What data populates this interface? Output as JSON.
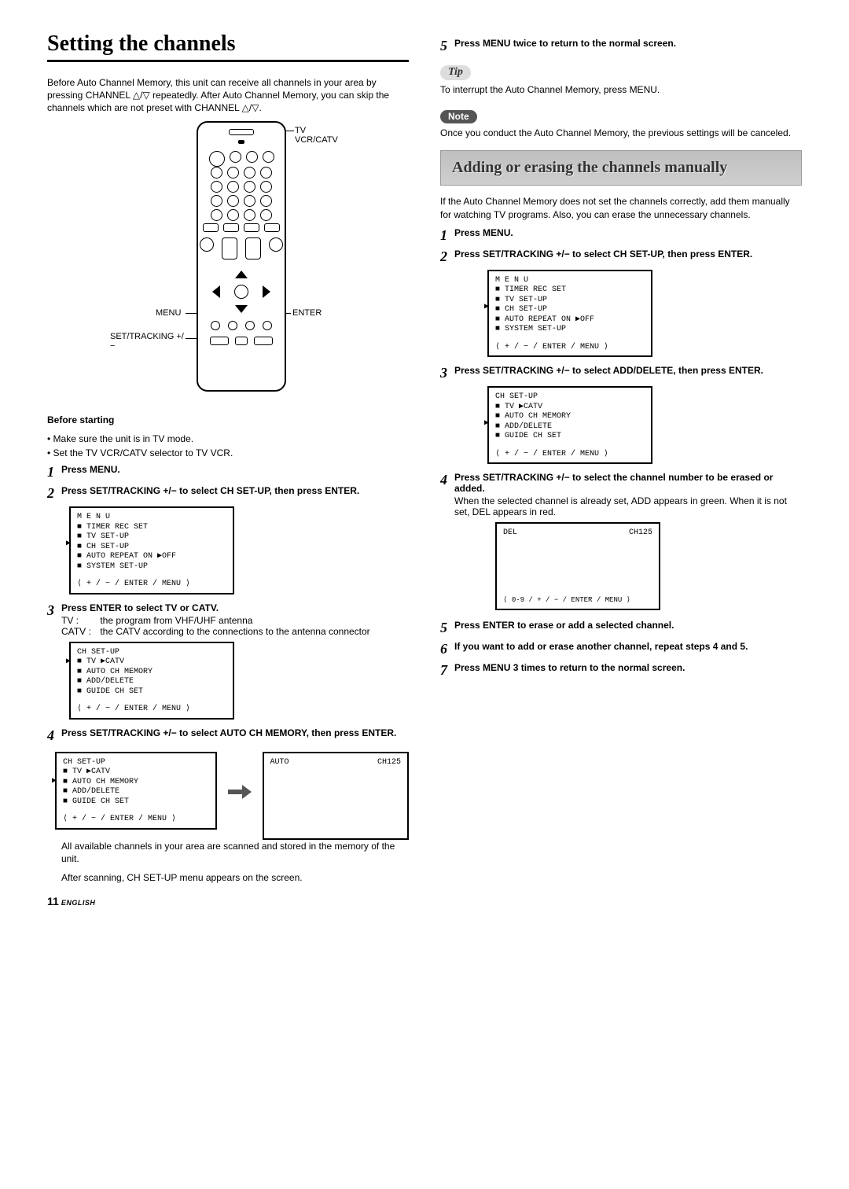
{
  "title": "Setting the channels",
  "intro": "Before Auto Channel Memory, this unit can receive all channels in your area by pressing CHANNEL △/▽ repeatedly. After Auto Channel Memory, you can skip the channels which are not preset with CHANNEL △/▽.",
  "remote_labels": {
    "tv_vcr_catv": "TV VCR/CATV",
    "menu": "MENU",
    "enter": "ENTER",
    "set_tracking": "SET/TRACKING +/−"
  },
  "before_starting": {
    "heading": "Before starting",
    "items": [
      "Make sure the unit is in TV mode.",
      "Set the TV VCR/CATV selector to TV VCR."
    ]
  },
  "left_steps": {
    "s1": "Press MENU.",
    "s2": "Press SET/TRACKING +/− to select CH SET-UP, then press ENTER.",
    "s3_title": "Press ENTER to select TV or CATV.",
    "s3_tv_label": "TV :",
    "s3_tv": "the program from VHF/UHF antenna",
    "s3_catv_label": "CATV :",
    "s3_catv": "the CATV according to the connections to the antenna connector",
    "s4": "Press SET/TRACKING +/− to select AUTO CH MEMORY, then press ENTER.",
    "s4_note1": "All available channels in your area are scanned and stored in the memory of the unit.",
    "s4_note2": "After scanning, CH SET-UP menu appears on the screen."
  },
  "menu1": {
    "title": "M E N U",
    "items": [
      "TIMER REC SET",
      "TV SET-UP",
      "CH SET-UP",
      "AUTO REPEAT   ON ▶OFF",
      "SYSTEM SET-UP"
    ],
    "footer": "⟨ + / − / ENTER / MENU ⟩"
  },
  "menu2": {
    "title": "CH SET-UP",
    "items": [
      "TV ▶CATV",
      "AUTO CH MEMORY",
      "ADD/DELETE",
      "GUIDE CH SET"
    ],
    "footer": "⟨ + / − / ENTER / MENU ⟩"
  },
  "menu3": {
    "title": "CH SET-UP",
    "items": [
      "TV ▶CATV",
      "AUTO CH MEMORY",
      "ADD/DELETE",
      "GUIDE CH SET"
    ],
    "footer": "⟨ + / − / ENTER / MENU ⟩"
  },
  "screen_auto": {
    "tl": "AUTO",
    "tr": "CH125"
  },
  "right": {
    "s5": "Press MENU twice to return to the normal screen.",
    "tip_label": "Tip",
    "tip": "To interrupt the Auto Channel Memory, press MENU.",
    "note_label": "Note",
    "note": "Once you conduct the Auto Channel Memory, the previous settings will be canceled.",
    "section_title": "Adding or erasing the channels manually",
    "section_intro": "If the Auto Channel Memory does not set the channels correctly, add them manually for watching TV programs. Also, you can erase the unnecessary channels.",
    "r1": "Press MENU.",
    "r2": "Press SET/TRACKING +/−  to select CH SET-UP, then press ENTER.",
    "r3": "Press SET/TRACKING +/− to select ADD/DELETE, then press ENTER.",
    "r4_title": "Press SET/TRACKING +/− to select the channel number to be erased or added.",
    "r4_body": "When the selected channel is already set, ADD appears in green. When it is not set, DEL appears in red.",
    "r5": "Press ENTER to erase or add a selected channel.",
    "r6": "If you want to add or erase another channel, repeat steps 4 and 5.",
    "r7": "Press MENU 3 times to return to the normal screen."
  },
  "menu_r1": {
    "title": "M E N U",
    "items": [
      "TIMER REC SET",
      "TV SET-UP",
      "CH SET-UP",
      "AUTO REPEAT   ON ▶OFF",
      "SYSTEM SET-UP"
    ],
    "footer": "⟨ + / − / ENTER / MENU ⟩"
  },
  "menu_r2": {
    "title": "CH SET-UP",
    "items": [
      "TV ▶CATV",
      "AUTO CH MEMORY",
      "ADD/DELETE",
      "GUIDE CH SET"
    ],
    "footer": "⟨ + / − / ENTER / MENU ⟩"
  },
  "screen_del": {
    "tl": "DEL",
    "tr": "CH125",
    "footer": "⟨ 0-9 / + / − / ENTER / MENU ⟩"
  },
  "page": {
    "num": "11",
    "lang": "ENGLISH"
  }
}
